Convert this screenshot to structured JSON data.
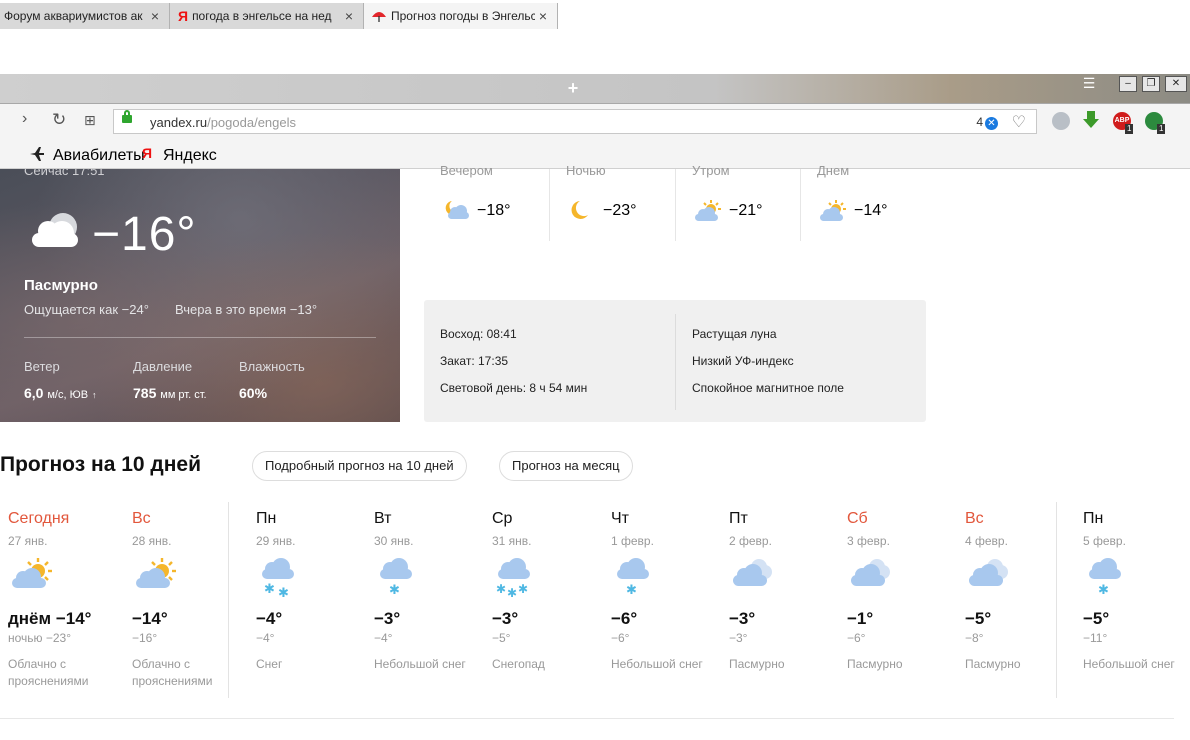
{
  "browser": {
    "tabs": [
      {
        "title": "Форум аквариумистов ак",
        "close": "×"
      },
      {
        "title": "погода в энгельсе на нед",
        "favicon": "Я",
        "close": "×"
      },
      {
        "title": "Прогноз погоды в Энгельс",
        "close": "×"
      }
    ],
    "new_tab": "+",
    "url_host": "yandex.ru",
    "url_path": "/pogoda/engels",
    "bookmark_count": "4",
    "ext_badge_abp": "ABP",
    "ext_badge_1": "1",
    "ext_badge_2": "1",
    "bookmarks": [
      {
        "label": "Авиабилеты"
      },
      {
        "label": "Яндекс"
      }
    ],
    "yandex_letter": "Я",
    "chrome_colors": {
      "tabbar": "#c4c4c4",
      "accent": "#1a7ae0",
      "lock": "#2fa62f"
    }
  },
  "current": {
    "time_label": "Сейчас 17:51",
    "temp": "−16°",
    "condition": "Пасмурно",
    "feels_like": "Ощущается как −24°",
    "yesterday": "Вчера в это время −13°",
    "wind_label": "Ветер",
    "wind_value": "6,0",
    "wind_unit": "м/с, ЮВ",
    "wind_arrow": "↑",
    "pressure_label": "Давление",
    "pressure_value": "785",
    "pressure_unit": "мм рт. ст.",
    "humidity_label": "Влажность",
    "humidity_value": "60%",
    "icon": "overcast-cloud-icon"
  },
  "day_parts": [
    {
      "name": "Вечером",
      "temp": "−18°",
      "icon": "night-cloud-icon"
    },
    {
      "name": "Ночью",
      "temp": "−23°",
      "icon": "moon-icon"
    },
    {
      "name": "Утром",
      "temp": "−21°",
      "icon": "partly-cloudy-icon"
    },
    {
      "name": "Днем",
      "temp": "−14°",
      "icon": "partly-cloudy-icon"
    }
  ],
  "sun": {
    "sunrise": "Восход: 08:41",
    "sunset": "Закат: 17:35",
    "daylight": "Световой день: 8 ч 54 мин",
    "moon": "Растущая луна",
    "uv": "Низкий УФ-индекс",
    "magnetic": "Спокойное магнитное поле"
  },
  "forecast": {
    "title": "Прогноз на 10 дней",
    "detailed_button": "Подробный прогноз на 10 дней",
    "month_button": "Прогноз на месяц",
    "days": [
      {
        "name": "Сегодня",
        "date": "27 янв.",
        "day": "днём −14°",
        "night": "ночью −23°",
        "desc": "Облачно с прояснениями",
        "icon": "partly-cloudy-icon",
        "weekend": true
      },
      {
        "name": "Вс",
        "date": "28 янв.",
        "day": "−14°",
        "night": "−16°",
        "desc": "Облачно с прояснениями",
        "icon": "partly-cloudy-icon",
        "weekend": true
      },
      {
        "name": "Пн",
        "date": "29 янв.",
        "day": "−4°",
        "night": "−4°",
        "desc": "Снег",
        "icon": "snow-icon",
        "weekend": false
      },
      {
        "name": "Вт",
        "date": "30 янв.",
        "day": "−3°",
        "night": "−4°",
        "desc": "Небольшой снег",
        "icon": "light-snow-icon",
        "weekend": false
      },
      {
        "name": "Ср",
        "date": "31 янв.",
        "day": "−3°",
        "night": "−5°",
        "desc": "Снегопад",
        "icon": "heavy-snow-icon",
        "weekend": false
      },
      {
        "name": "Чт",
        "date": "1 февр.",
        "day": "−6°",
        "night": "−6°",
        "desc": "Небольшой снег",
        "icon": "light-snow-icon",
        "weekend": false
      },
      {
        "name": "Пт",
        "date": "2 февр.",
        "day": "−3°",
        "night": "−3°",
        "desc": "Пасмурно",
        "icon": "overcast-icon",
        "weekend": false
      },
      {
        "name": "Сб",
        "date": "3 февр.",
        "day": "−1°",
        "night": "−6°",
        "desc": "Пасмурно",
        "icon": "overcast-icon",
        "weekend": true
      },
      {
        "name": "Вс",
        "date": "4 февр.",
        "day": "−5°",
        "night": "−8°",
        "desc": "Пасмурно",
        "icon": "overcast-icon",
        "weekend": true
      },
      {
        "name": "Пн",
        "date": "5 февр.",
        "day": "−5°",
        "night": "−11°",
        "desc": "Небольшой снег",
        "icon": "light-snow-icon",
        "weekend": false
      }
    ],
    "colors": {
      "weekend": "#e2573c",
      "muted": "#999999"
    }
  }
}
